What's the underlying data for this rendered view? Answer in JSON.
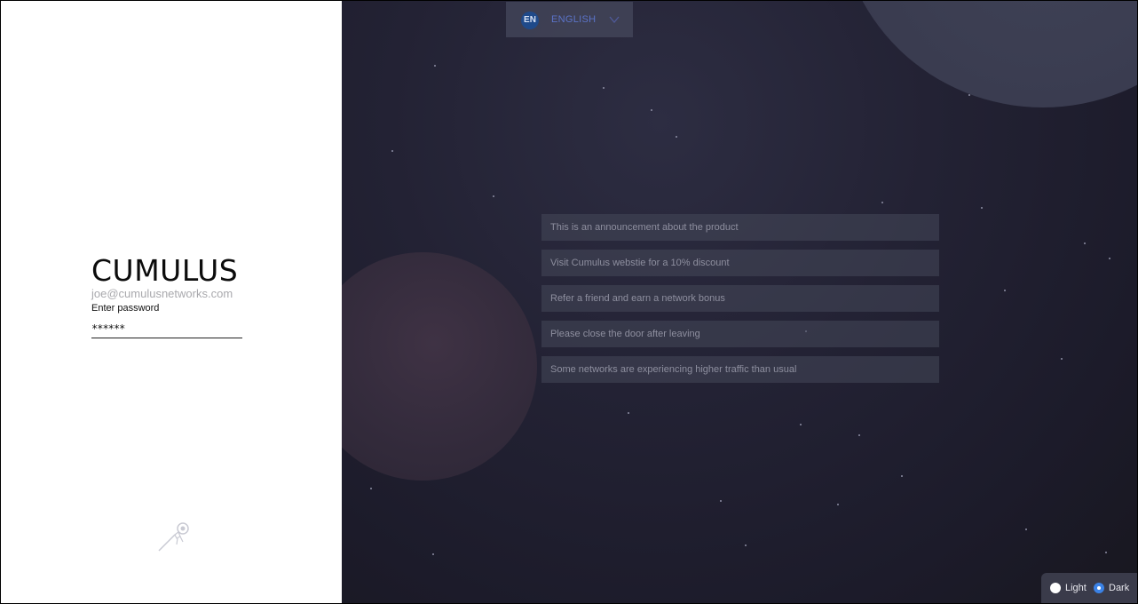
{
  "brand": {
    "name": "CUMULUS"
  },
  "login": {
    "email": "joe@cumulusnetworks.com",
    "password_label": "Enter password",
    "password_value": "******"
  },
  "language": {
    "code": "EN",
    "name": "ENGLISH"
  },
  "announcements": [
    "This is an announcement about the product",
    "Visit Cumulus webstie for a 10% discount",
    "Refer a friend and earn a network bonus",
    "Please close the door after leaving",
    "Some networks are experiencing higher traffic than usual"
  ],
  "theme": {
    "light_label": "Light",
    "dark_label": "Dark",
    "selected": "Dark"
  },
  "icons": {
    "rocket": "rocket-icon",
    "chevron": "chevron-down-icon"
  },
  "colors": {
    "accent": "#3b82e6",
    "language_text": "#5b73c8"
  }
}
